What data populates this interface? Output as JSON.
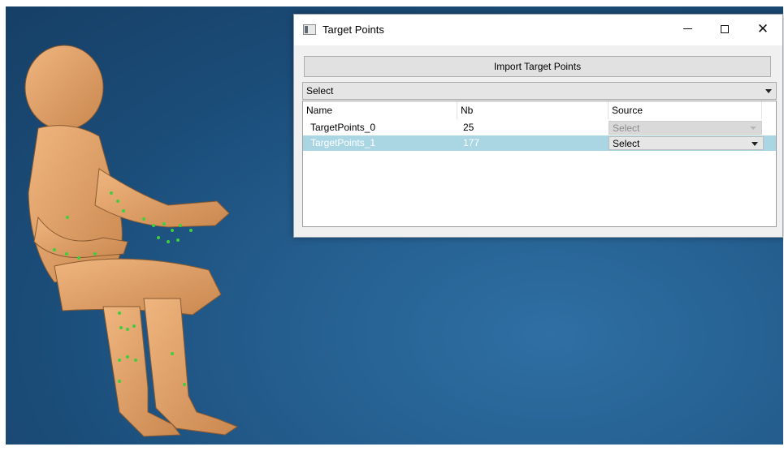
{
  "window": {
    "title": "Target Points",
    "icon": "window-app-icon"
  },
  "controls": {
    "import_label": "Import Target Points",
    "select_value": "Select"
  },
  "table": {
    "columns": [
      "Name",
      "Nb",
      "Source"
    ],
    "rows": [
      {
        "name": "TargetPoints_0",
        "nb": "25",
        "source": "Select",
        "selected": false,
        "source_enabled": false
      },
      {
        "name": "TargetPoints_1",
        "nb": "177",
        "source": "Select",
        "selected": true,
        "source_enabled": true
      }
    ]
  },
  "colors": {
    "viewport_bg": "#1f5a8a",
    "selection": "#aad6e4",
    "model_skin": "#e0a26b",
    "marker": "#3ecf3e"
  }
}
